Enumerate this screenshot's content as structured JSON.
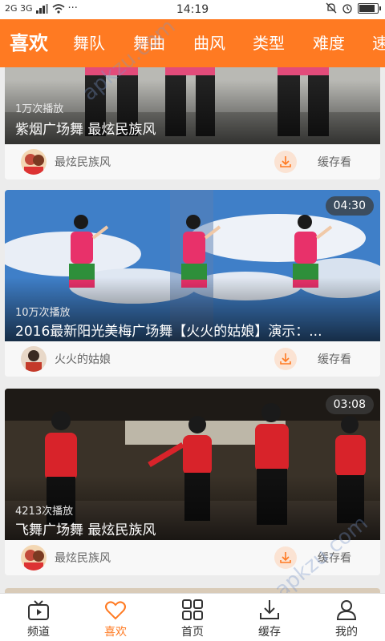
{
  "statusbar": {
    "left": "2G 3G",
    "time": "14:19"
  },
  "topnav": {
    "tabs": [
      {
        "label": "喜欢",
        "active": true
      },
      {
        "label": "舞队"
      },
      {
        "label": "舞曲"
      },
      {
        "label": "曲风"
      },
      {
        "label": "类型"
      },
      {
        "label": "难度"
      },
      {
        "label": "速"
      }
    ]
  },
  "feed": [
    {
      "plays": "1万次播放",
      "title": "紫烟广场舞 最炫民族风",
      "author": "最炫民族风",
      "download_label": "缓存看",
      "duration": ""
    },
    {
      "plays": "10万次播放",
      "title": "2016最新阳光美梅广场舞【火火的姑娘】演示：...",
      "author": "火火的姑娘",
      "download_label": "缓存看",
      "duration": "04:30"
    },
    {
      "plays": "4213次播放",
      "title": "飞舞广场舞 最炫民族风",
      "author": "最炫民族风",
      "download_label": "缓存看",
      "duration": "03:08"
    }
  ],
  "bottom_nav": [
    {
      "label": "频道",
      "icon": "channel-icon"
    },
    {
      "label": "喜欢",
      "icon": "heart-icon",
      "active": true
    },
    {
      "label": "首页",
      "icon": "grid-icon"
    },
    {
      "label": "缓存",
      "icon": "download-icon"
    },
    {
      "label": "我的",
      "icon": "person-icon"
    }
  ],
  "watermark": "apkzu.com",
  "colors": {
    "accent": "#ff7a22",
    "download_bg": "#fbe3d3"
  }
}
